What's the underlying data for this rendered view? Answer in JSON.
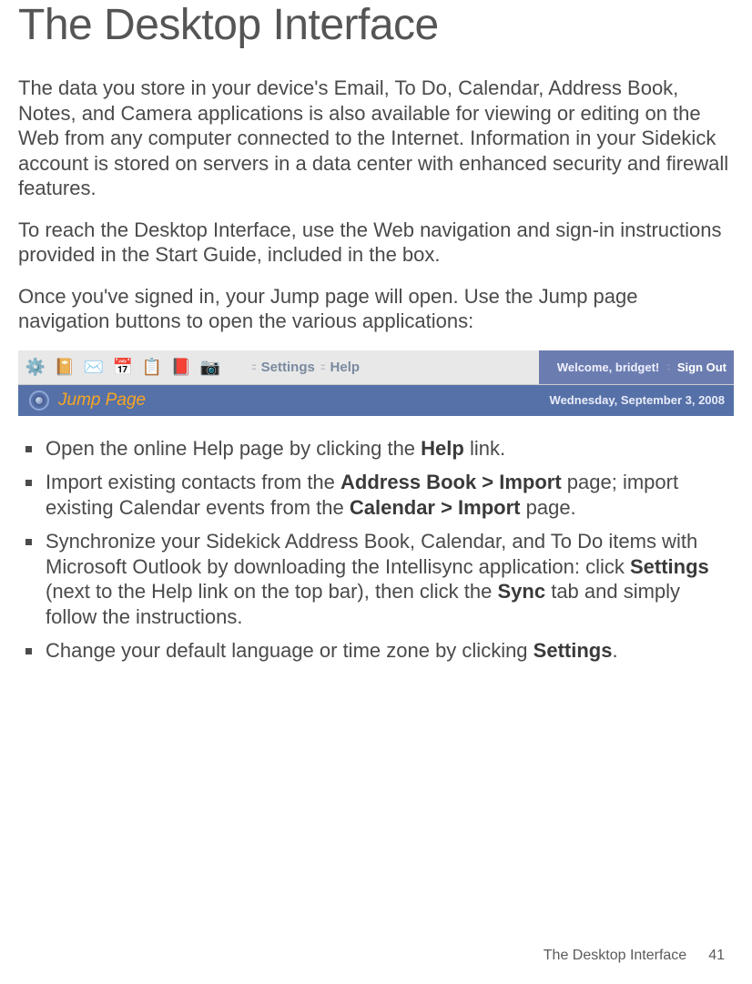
{
  "title": "The Desktop Interface",
  "para1": "The data you store in your device's Email, To Do, Calendar, Address Book, Notes, and Camera applications is also available for viewing or editing on the Web from any computer connected to the Internet. Information in your Sidekick account is stored on servers in a data center with enhanced security and firewall features.",
  "para2": "To reach the Desktop Interface, use the Web navigation and sign-in instructions provided in the Start Guide, included in the box.",
  "para3": "Once you've signed in, your Jump page will open. Use the Jump page navigation buttons to open the various applications:",
  "toolbar": {
    "settings": "Settings",
    "help": "Help",
    "welcome": "Welcome, bridget!",
    "signout": "Sign Out",
    "jump": "Jump Page",
    "date": "Wednesday, September 3, 2008"
  },
  "bullets": {
    "b1_pre": "Open the online Help page by clicking the ",
    "b1_bold": "Help",
    "b1_post": " link.",
    "b2_pre": "Import existing contacts from the ",
    "b2_bold1": "Address Book > Import",
    "b2_mid": " page; import existing Calendar events from the ",
    "b2_bold2": "Calendar > Import",
    "b2_post": " page.",
    "b3_pre": "Synchronize your Sidekick Address Book, Calendar, and To Do items with Microsoft Outlook by downloading the Intellisync application: click ",
    "b3_bold1": "Settings",
    "b3_mid": " (next to the Help link on the top bar), then click the ",
    "b3_bold2": "Sync",
    "b3_post": " tab and simply follow the instructions.",
    "b4_pre": "Change your default language or time zone by clicking ",
    "b4_bold": "Settings",
    "b4_post": "."
  },
  "footer": {
    "section": "The Desktop Interface",
    "page": "41"
  }
}
